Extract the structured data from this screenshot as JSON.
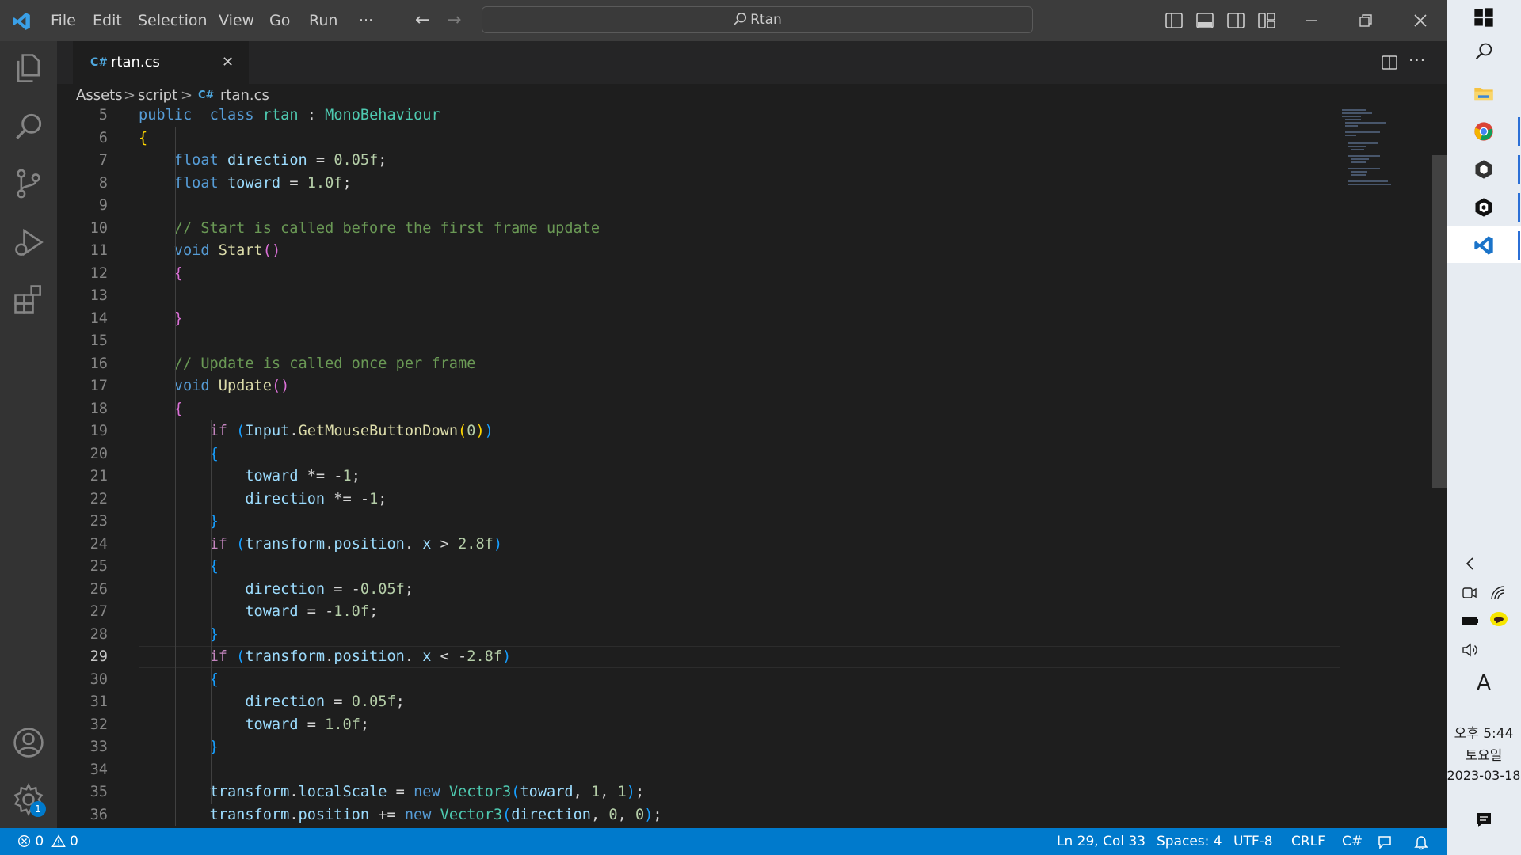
{
  "titlebar": {
    "menu": [
      "File",
      "Edit",
      "Selection",
      "View",
      "Go",
      "Run",
      "···"
    ],
    "search_text": "Rtan"
  },
  "tab": {
    "glyph": "C#",
    "label": "rtan.cs",
    "close": "✕"
  },
  "breadcrumb": {
    "parts": [
      "Assets",
      ">",
      "script",
      ">",
      "rtan.cs"
    ],
    "glyph": "C#"
  },
  "editor": {
    "current_line": 29,
    "lines": [
      {
        "n": "5",
        "segs": [
          [
            "kw",
            "public"
          ],
          [
            "",
            "  "
          ],
          [
            "kw",
            "class"
          ],
          [
            "",
            ""
          ],
          [
            "ty",
            " rtan"
          ],
          [
            "",
            " : "
          ],
          [
            "ty",
            "MonoBehaviour"
          ]
        ]
      },
      {
        "n": "6",
        "segs": [
          [
            "b1",
            "{"
          ]
        ]
      },
      {
        "n": "7",
        "segs": [
          [
            "",
            "    "
          ],
          [
            "kw",
            "float"
          ],
          [
            "va",
            " direction"
          ],
          [
            "",
            " = "
          ],
          [
            "nu",
            "0.05f"
          ],
          [
            "",
            ";"
          ]
        ]
      },
      {
        "n": "8",
        "segs": [
          [
            "",
            "    "
          ],
          [
            "kw",
            "float"
          ],
          [
            "va",
            " toward"
          ],
          [
            "",
            " = "
          ],
          [
            "nu",
            "1.0f"
          ],
          [
            "",
            ";"
          ]
        ]
      },
      {
        "n": "9",
        "segs": []
      },
      {
        "n": "10",
        "segs": [
          [
            "",
            "    "
          ],
          [
            "cm",
            "// Start is called before the first frame update"
          ]
        ]
      },
      {
        "n": "11",
        "segs": [
          [
            "",
            "    "
          ],
          [
            "kw",
            "void"
          ],
          [
            "",
            " "
          ],
          [
            "fn",
            "Start"
          ],
          [
            "b2",
            "()"
          ]
        ]
      },
      {
        "n": "12",
        "segs": [
          [
            "",
            "    "
          ],
          [
            "b2",
            "{"
          ]
        ]
      },
      {
        "n": "13",
        "segs": []
      },
      {
        "n": "14",
        "segs": [
          [
            "",
            "    "
          ],
          [
            "b2",
            "}"
          ]
        ]
      },
      {
        "n": "15",
        "segs": []
      },
      {
        "n": "16",
        "segs": [
          [
            "",
            "    "
          ],
          [
            "cm",
            "// Update is called once per frame"
          ]
        ]
      },
      {
        "n": "17",
        "segs": [
          [
            "",
            "    "
          ],
          [
            "kw",
            "void"
          ],
          [
            "",
            " "
          ],
          [
            "fn",
            "Update"
          ],
          [
            "b2",
            "()"
          ]
        ]
      },
      {
        "n": "18",
        "segs": [
          [
            "",
            "    "
          ],
          [
            "b2",
            "{"
          ]
        ]
      },
      {
        "n": "19",
        "segs": [
          [
            "",
            "        "
          ],
          [
            "kw2",
            "if"
          ],
          [
            "",
            " "
          ],
          [
            "b3",
            "("
          ],
          [
            "va",
            "Input"
          ],
          [
            "",
            "."
          ],
          [
            "fn",
            "GetMouseButtonDown"
          ],
          [
            "b1",
            "("
          ],
          [
            "nu",
            "0"
          ],
          [
            "b1",
            ")"
          ],
          [
            "b3",
            ")"
          ]
        ]
      },
      {
        "n": "20",
        "segs": [
          [
            "",
            "        "
          ],
          [
            "b3",
            "{"
          ]
        ]
      },
      {
        "n": "21",
        "segs": [
          [
            "",
            "            "
          ],
          [
            "va",
            "toward"
          ],
          [
            "",
            " *= -"
          ],
          [
            "nu",
            "1"
          ],
          [
            "",
            ";"
          ]
        ]
      },
      {
        "n": "22",
        "segs": [
          [
            "",
            "            "
          ],
          [
            "va",
            "direction"
          ],
          [
            "",
            " *= -"
          ],
          [
            "nu",
            "1"
          ],
          [
            "",
            ";"
          ]
        ]
      },
      {
        "n": "23",
        "segs": [
          [
            "",
            "        "
          ],
          [
            "b3",
            "}"
          ]
        ]
      },
      {
        "n": "24",
        "segs": [
          [
            "",
            "        "
          ],
          [
            "kw2",
            "if"
          ],
          [
            "",
            " "
          ],
          [
            "b3",
            "("
          ],
          [
            "va",
            "transform"
          ],
          [
            "",
            "."
          ],
          [
            "va",
            "position"
          ],
          [
            "",
            ". "
          ],
          [
            "va",
            "x"
          ],
          [
            "",
            " > "
          ],
          [
            "nu",
            "2.8f"
          ],
          [
            "b3",
            ")"
          ]
        ]
      },
      {
        "n": "25",
        "segs": [
          [
            "",
            "        "
          ],
          [
            "b3",
            "{"
          ]
        ]
      },
      {
        "n": "26",
        "segs": [
          [
            "",
            "            "
          ],
          [
            "va",
            "direction"
          ],
          [
            "",
            " = -"
          ],
          [
            "nu",
            "0.05f"
          ],
          [
            "",
            ";"
          ]
        ]
      },
      {
        "n": "27",
        "segs": [
          [
            "",
            "            "
          ],
          [
            "va",
            "toward"
          ],
          [
            "",
            " = -"
          ],
          [
            "nu",
            "1.0f"
          ],
          [
            "",
            ";"
          ]
        ]
      },
      {
        "n": "28",
        "segs": [
          [
            "",
            "        "
          ],
          [
            "b3",
            "}"
          ]
        ]
      },
      {
        "n": "29",
        "segs": [
          [
            "",
            "        "
          ],
          [
            "kw2",
            "if"
          ],
          [
            "",
            " "
          ],
          [
            "b3",
            "("
          ],
          [
            "va",
            "transform"
          ],
          [
            "",
            "."
          ],
          [
            "va",
            "position"
          ],
          [
            "",
            ". "
          ],
          [
            "va",
            "x"
          ],
          [
            "",
            " < -"
          ],
          [
            "nu",
            "2.8f"
          ],
          [
            "b3",
            ")"
          ]
        ]
      },
      {
        "n": "30",
        "segs": [
          [
            "",
            "        "
          ],
          [
            "b3",
            "{"
          ]
        ]
      },
      {
        "n": "31",
        "segs": [
          [
            "",
            "            "
          ],
          [
            "va",
            "direction"
          ],
          [
            "",
            " = "
          ],
          [
            "nu",
            "0.05f"
          ],
          [
            "",
            ";"
          ]
        ]
      },
      {
        "n": "32",
        "segs": [
          [
            "",
            "            "
          ],
          [
            "va",
            "toward"
          ],
          [
            "",
            " = "
          ],
          [
            "nu",
            "1.0f"
          ],
          [
            "",
            ";"
          ]
        ]
      },
      {
        "n": "33",
        "segs": [
          [
            "",
            "        "
          ],
          [
            "b3",
            "}"
          ]
        ]
      },
      {
        "n": "34",
        "segs": []
      },
      {
        "n": "35",
        "segs": [
          [
            "",
            "        "
          ],
          [
            "va",
            "transform"
          ],
          [
            "",
            "."
          ],
          [
            "va",
            "localScale"
          ],
          [
            "",
            " = "
          ],
          [
            "kw",
            "new"
          ],
          [
            "",
            " "
          ],
          [
            "ty",
            "Vector3"
          ],
          [
            "b3",
            "("
          ],
          [
            "va",
            "toward"
          ],
          [
            "",
            ", "
          ],
          [
            "nu",
            "1"
          ],
          [
            "",
            ", "
          ],
          [
            "nu",
            "1"
          ],
          [
            "b3",
            ")"
          ],
          [
            "",
            ";"
          ]
        ]
      },
      {
        "n": "36",
        "segs": [
          [
            "",
            "        "
          ],
          [
            "va",
            "transform"
          ],
          [
            "",
            "."
          ],
          [
            "va",
            "position"
          ],
          [
            "",
            " += "
          ],
          [
            "kw",
            "new"
          ],
          [
            "",
            " "
          ],
          [
            "ty",
            "Vector3"
          ],
          [
            "b3",
            "("
          ],
          [
            "va",
            "direction"
          ],
          [
            "",
            ", "
          ],
          [
            "nu",
            "0"
          ],
          [
            "",
            ", "
          ],
          [
            "nu",
            "0"
          ],
          [
            "b3",
            ")"
          ],
          [
            "",
            ";"
          ]
        ]
      }
    ]
  },
  "status": {
    "errors": "0",
    "warnings": "0",
    "position": "Ln 29, Col 33",
    "spaces": "Spaces: 4",
    "encoding": "UTF-8",
    "eol": "CRLF",
    "language": "C#"
  },
  "activity": {
    "settings_badge": "1"
  },
  "taskbar": {
    "time": "오후 5:44",
    "day": "토요일",
    "date": "2023-03-18",
    "ime": "A"
  },
  "colors": {
    "accent": "#007acc",
    "titlebar": "#3c3c3c",
    "editor_bg": "#1e1e1e"
  }
}
